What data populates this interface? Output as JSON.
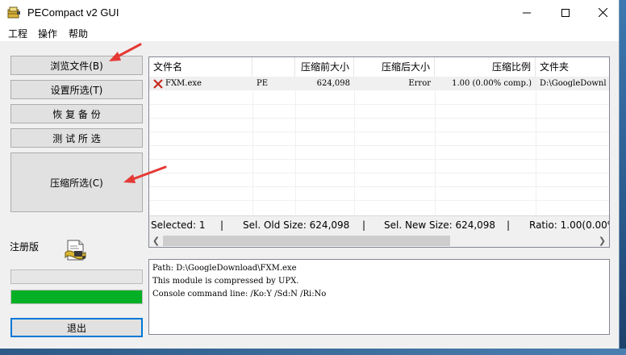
{
  "window": {
    "title": "PECompact v2 GUI",
    "controls": {
      "minimize": "minimize",
      "maximize": "maximize",
      "close": "close"
    }
  },
  "menu": [
    "工程",
    "操作",
    "帮助"
  ],
  "buttons": {
    "browse": "浏览文件(B)",
    "settings": "设置所选(T)",
    "restore": "恢 复 备 份",
    "test": "测 试 所 选",
    "compress": "压缩所选(C)",
    "exit": "退出"
  },
  "registration_label": "注册版",
  "progress": {
    "bar1": 0,
    "bar2": 1
  },
  "list": {
    "columns": [
      "文件名",
      "",
      "压缩前大小",
      "压缩后大小",
      "压缩比例",
      "文件夹"
    ],
    "rows": [
      {
        "name": "FXM.exe",
        "type": "PE",
        "orig_size": "624,098",
        "new_size": "Error",
        "ratio": "1.00 (0.00% comp.)",
        "folder": "D:\\GoogleDownl"
      }
    ]
  },
  "status": {
    "selected": "Selected: 1",
    "old_size": "Sel. Old Size: 624,098",
    "new_size": "Sel. New Size: 624,098",
    "ratio": "Ratio: 1.00(0.00%"
  },
  "output_lines": [
    "Path: D:\\GoogleDownload\\FXM.exe",
    "This module is compressed by UPX.",
    "Console command line: /Ko:Y /Sd:N /Ri:No"
  ],
  "colors": {
    "progress_fill": "#06b025",
    "error_icon": "#c42b1c",
    "annotation_arrow": "#e53935"
  }
}
